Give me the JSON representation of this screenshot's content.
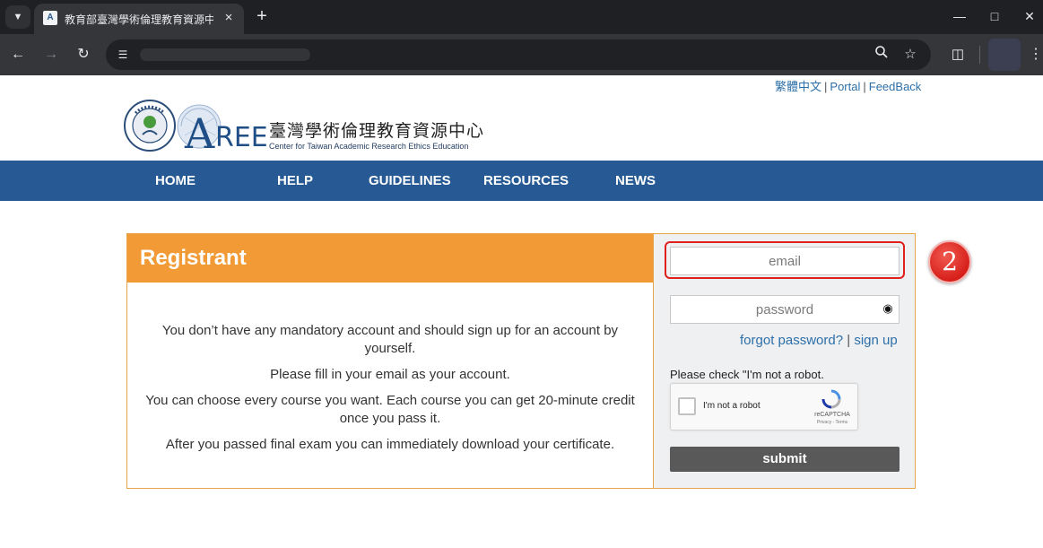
{
  "browser": {
    "tab_title": "教育部臺灣學術倫理教育資源中心",
    "tab_menu_icon": "chevron-down-icon",
    "new_tab_icon": "plus-icon",
    "window_controls": [
      "minimize",
      "maximize",
      "close"
    ]
  },
  "toplinks": {
    "lang": "繁體中文",
    "portal": "Portal",
    "feedback": "FeedBack",
    "separator": "|"
  },
  "site": {
    "logo_text": "AREE",
    "title_zh": "臺灣學術倫理教育資源中心",
    "title_en": "Center for Taiwan Academic Research Ethics Education"
  },
  "nav": {
    "items": [
      "HOME",
      "HELP",
      "GUIDELINES",
      "RESOURCES",
      "NEWS"
    ]
  },
  "registrant": {
    "title": "Registrant",
    "lines": [
      "You don’t have any mandatory account and should sign up for an account by yourself.",
      "Please fill in your email as your account.",
      "You can choose every course you want. Each course you can get 20-minute credit once you pass it.",
      "After you passed final exam you can immediately download your certificate."
    ]
  },
  "login": {
    "email_placeholder": "email",
    "password_placeholder": "password",
    "forgot_label": "forgot password?",
    "link_separator": "|",
    "signup_label": "sign up",
    "robot_note": "Please check \"I'm not a robot.",
    "captcha_label": "I'm not a robot",
    "captcha_brand": "reCAPTCHA",
    "captcha_terms": "Privacy - Terms",
    "submit_label": "submit"
  },
  "annotation": {
    "step": "2",
    "color": "#e0201a"
  },
  "colors": {
    "nav_bg": "#275a94",
    "panel_head": "#f29b36",
    "link": "#2d6fa8"
  }
}
